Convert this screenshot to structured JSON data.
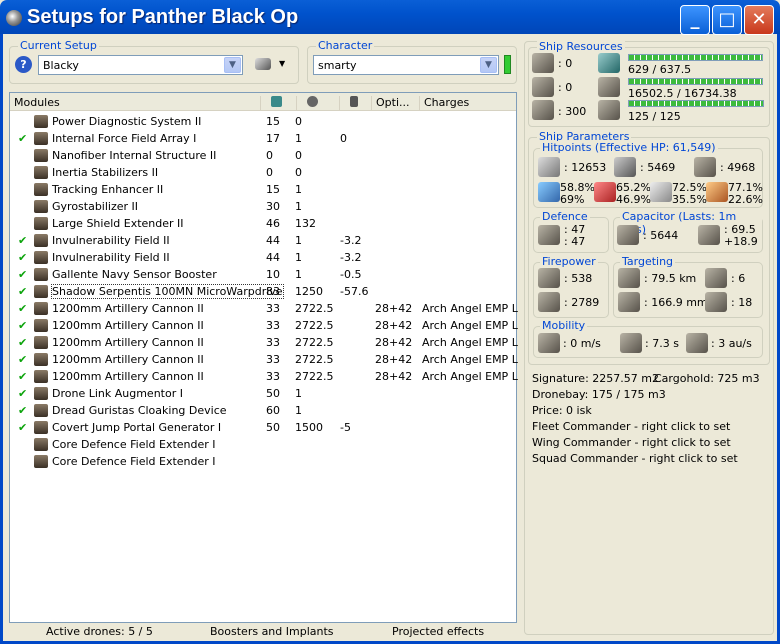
{
  "window": {
    "title": "Setups for Panther Black Op",
    "minimize": "_",
    "maximize": "□",
    "close": "✕"
  },
  "setup": {
    "label": "Current Setup",
    "value": "Blacky",
    "help": "?"
  },
  "character": {
    "label": "Character",
    "value": "smarty"
  },
  "modules": {
    "headers": [
      "Modules",
      "",
      "",
      "",
      "Opti...",
      "Charges"
    ],
    "rows": [
      {
        "check": "",
        "name": "Power Diagnostic System II",
        "c1": "15",
        "c2": "0",
        "c3": "",
        "opt": "",
        "charge": ""
      },
      {
        "check": "✔",
        "name": "Internal Force Field Array I",
        "c1": "17",
        "c2": "1",
        "c3": "0",
        "opt": "",
        "charge": ""
      },
      {
        "check": "",
        "name": "Nanofiber Internal Structure II",
        "c1": "0",
        "c2": "0",
        "c3": "",
        "opt": "",
        "charge": ""
      },
      {
        "check": "",
        "name": "Inertia Stabilizers II",
        "c1": "0",
        "c2": "0",
        "c3": "",
        "opt": "",
        "charge": ""
      },
      {
        "check": "",
        "name": "Tracking Enhancer II",
        "c1": "15",
        "c2": "1",
        "c3": "",
        "opt": "",
        "charge": ""
      },
      {
        "check": "",
        "name": "Gyrostabilizer II",
        "c1": "30",
        "c2": "1",
        "c3": "",
        "opt": "",
        "charge": ""
      },
      {
        "check": "",
        "name": "Large Shield Extender II",
        "c1": "46",
        "c2": "132",
        "c3": "",
        "opt": "",
        "charge": ""
      },
      {
        "check": "✔",
        "name": "Invulnerability Field II",
        "c1": "44",
        "c2": "1",
        "c3": "-3.2",
        "opt": "",
        "charge": ""
      },
      {
        "check": "✔",
        "name": "Invulnerability Field II",
        "c1": "44",
        "c2": "1",
        "c3": "-3.2",
        "opt": "",
        "charge": ""
      },
      {
        "check": "✔",
        "name": "Gallente Navy Sensor Booster",
        "c1": "10",
        "c2": "1",
        "c3": "-0.5",
        "opt": "",
        "charge": ""
      },
      {
        "check": "✔",
        "name": "Shadow Serpentis 100MN MicroWarpdrive",
        "c1": "83",
        "c2": "1250",
        "c3": "-57.6",
        "opt": "",
        "charge": ""
      },
      {
        "check": "✔",
        "name": "1200mm Artillery Cannon II",
        "c1": "33",
        "c2": "2722.5",
        "c3": "",
        "opt": "28+42",
        "charge": "Arch Angel EMP L"
      },
      {
        "check": "✔",
        "name": "1200mm Artillery Cannon II",
        "c1": "33",
        "c2": "2722.5",
        "c3": "",
        "opt": "28+42",
        "charge": "Arch Angel EMP L"
      },
      {
        "check": "✔",
        "name": "1200mm Artillery Cannon II",
        "c1": "33",
        "c2": "2722.5",
        "c3": "",
        "opt": "28+42",
        "charge": "Arch Angel EMP L"
      },
      {
        "check": "✔",
        "name": "1200mm Artillery Cannon II",
        "c1": "33",
        "c2": "2722.5",
        "c3": "",
        "opt": "28+42",
        "charge": "Arch Angel EMP L"
      },
      {
        "check": "✔",
        "name": "1200mm Artillery Cannon II",
        "c1": "33",
        "c2": "2722.5",
        "c3": "",
        "opt": "28+42",
        "charge": "Arch Angel EMP L"
      },
      {
        "check": "✔",
        "name": "Drone Link Augmentor I",
        "c1": "50",
        "c2": "1",
        "c3": "",
        "opt": "",
        "charge": ""
      },
      {
        "check": "✔",
        "name": "Dread Guristas Cloaking Device",
        "c1": "60",
        "c2": "1",
        "c3": "",
        "opt": "",
        "charge": ""
      },
      {
        "check": "✔",
        "name": "Covert Jump Portal Generator I",
        "c1": "50",
        "c2": "1500",
        "c3": "-5",
        "opt": "",
        "charge": ""
      },
      {
        "check": "",
        "name": "Core Defence Field Extender I",
        "c1": "",
        "c2": "",
        "c3": "",
        "opt": "",
        "charge": ""
      },
      {
        "check": "",
        "name": "Core Defence Field Extender I",
        "c1": "",
        "c2": "",
        "c3": "",
        "opt": "",
        "charge": ""
      }
    ]
  },
  "status": {
    "drones": "Active drones: 5 / 5",
    "boosters": "Boosters and Implants",
    "projected": "Projected effects"
  },
  "resources": {
    "label": "Ship Resources",
    "turrets": ": 0",
    "launchers": ": 0",
    "calibration": ": 300",
    "cpu": "629 / 637.5",
    "cpu_frac": 0.99,
    "power": "16502.5 / 16734.38",
    "power_frac": 0.99,
    "drones": "125 / 125",
    "drones_frac": 1.0
  },
  "params": {
    "label": "Ship Parameters",
    "hitpoints": {
      "label": "Hitpoints (Effective HP: 61,549)",
      "shield": ": 12653",
      "armor": ": 5469",
      "hull": ": 4968",
      "res": [
        [
          "58.8%",
          "69%"
        ],
        [
          "65.2%",
          "46.9%"
        ],
        [
          "72.5%",
          "35.5%"
        ],
        [
          "77.1%",
          "22.6%"
        ]
      ]
    },
    "defence": {
      "label": "Defence",
      "a": ": 47",
      "b": ": 47"
    },
    "capacitor": {
      "label": "Capacitor (Lasts: 1m 41s)",
      "value": ": 5644",
      "r1": ": 69.5",
      "r2": "+18.9"
    },
    "firepower": {
      "label": "Firepower",
      "a": ": 538",
      "b": ": 2789"
    },
    "targeting": {
      "label": "Targeting",
      "range": ": 79.5 km",
      "targets": ": 6",
      "res": ": 166.9 mm",
      "scan": ": 18"
    },
    "mobility": {
      "label": "Mobility",
      "speed": ": 0 m/s",
      "align": ": 7.3 s",
      "warp": ": 3 au/s"
    },
    "signature": "Signature: 2257.57 m2",
    "cargo": "Cargohold: 725 m3",
    "dronebay": "Dronebay: 175 / 175 m3",
    "price": "Price: 0 isk",
    "fleet": "Fleet Commander - right click to set",
    "wing": "Wing Commander - right click to set",
    "squad": "Squad Commander - right click to set"
  }
}
